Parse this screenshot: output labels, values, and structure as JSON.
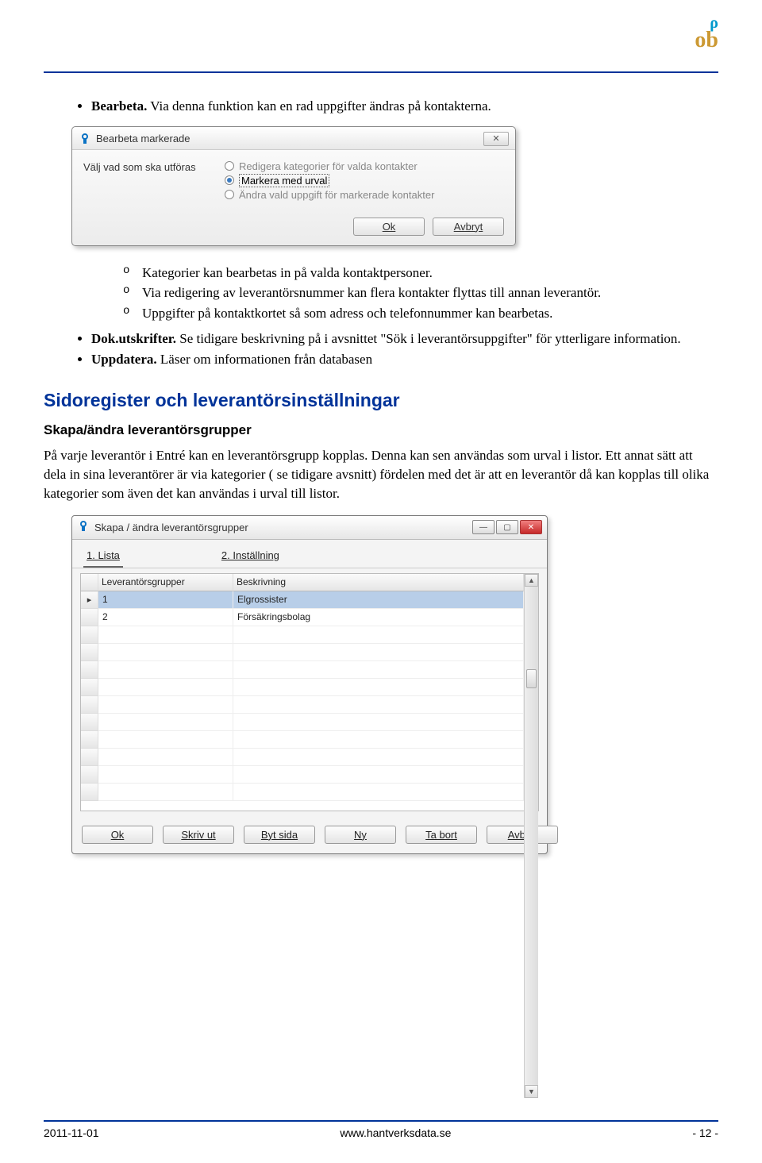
{
  "logo": {
    "top": "ρ",
    "bottom": "ob"
  },
  "intro": {
    "b1_label": "Bearbeta.",
    "b1_text": " Via denna funktion kan en rad uppgifter ändras på kontakterna."
  },
  "dialog1": {
    "title": "Bearbeta markerade",
    "prompt": "Välj vad som ska utföras",
    "options": [
      "Redigera kategorier för valda kontakter",
      "Markera med urval",
      "Ändra vald uppgift för markerade kontakter"
    ],
    "ok": "Ok",
    "cancel": "Avbryt"
  },
  "sub_items": [
    "Kategorier kan bearbetas in på valda kontaktpersoner.",
    "Via redigering av leverantörsnummer  kan flera kontakter flyttas till annan leverantör.",
    "Uppgifter på kontaktkortet så som adress och telefonnummer kan bearbetas."
  ],
  "more": {
    "dok_label": "Dok.utskrifter.",
    "dok_text": " Se tidigare beskrivning på i avsnittet \"Sök i leverantörsuppgifter\" för ytterligare information.",
    "upp_label": "Uppdatera.",
    "upp_text": " Läser om informationen från databasen"
  },
  "h2": "Sidoregister och leverantörsinställningar",
  "h3": "Skapa/ändra leverantörsgrupper",
  "para": "På varje leverantör i Entré kan en leverantörsgrupp kopplas. Denna kan sen användas som urval i listor. Ett annat sätt att dela in sina leverantörer är via kategorier ( se tidigare avsnitt) fördelen med det är att en leverantör då kan kopplas till olika kategorier som även det kan användas i urval till listor.",
  "dialog2": {
    "title": "Skapa / ändra leverantörsgrupper",
    "tabs": {
      "t1": "1. Lista",
      "t2": "2. Inställning"
    },
    "cols": {
      "c1": "Leverantörsgrupper",
      "c2": "Beskrivning"
    },
    "rows": [
      {
        "id": "1",
        "desc": "Elgrossister"
      },
      {
        "id": "2",
        "desc": "Försäkringsbolag"
      }
    ],
    "buttons": {
      "ok": "Ok",
      "print": "Skriv ut",
      "page": "Byt sida",
      "new": "Ny",
      "del": "Ta bort",
      "cancel": "Avbryt"
    }
  },
  "footer": {
    "left": "2011-11-01",
    "center": "www.hantverksdata.se",
    "right": "- 12 -"
  }
}
